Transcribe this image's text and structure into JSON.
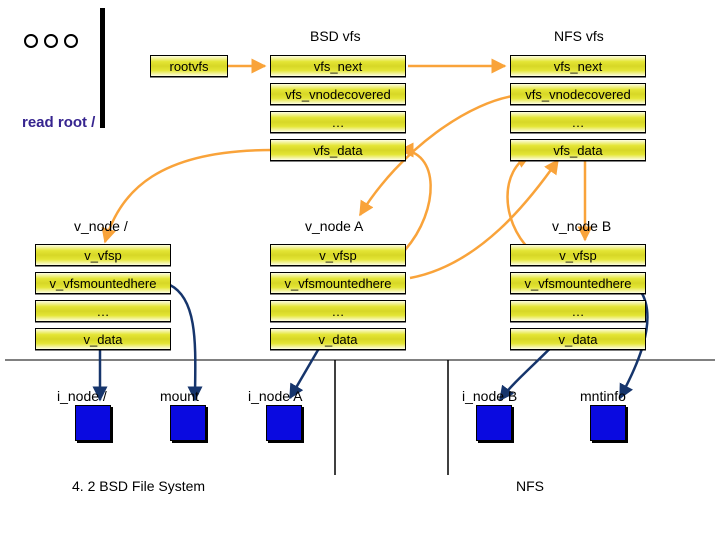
{
  "headers": {
    "bsd": "BSD vfs",
    "nfs": "NFS vfs"
  },
  "rootvfs": "rootvfs",
  "readroot": "read root /",
  "vfsCols": {
    "bsd": [
      "vfs_next",
      "vfs_vnodecovered",
      "…",
      "vfs_data"
    ],
    "nfs": [
      "vfs_next",
      "vfs_vnodecovered",
      "…",
      "vfs_data"
    ]
  },
  "vnodeTitles": {
    "root": "v_node /",
    "a": "v_node A",
    "b": "v_node B"
  },
  "vnodeCols": {
    "root": [
      "v_vfsp",
      "v_vfsmountedhere",
      "…",
      "v_data"
    ],
    "a": [
      "v_vfsp",
      "v_vfsmountedhere",
      "…",
      "v_data"
    ],
    "b": [
      "v_vfsp",
      "v_vfsmountedhere",
      "…",
      "v_data"
    ]
  },
  "bottomLabels": {
    "inodeRoot": "i_node /",
    "mount": "mount",
    "inodeA": "i_node A",
    "inodeB": "i_node B",
    "mntinfo": "mntinfo"
  },
  "footer": {
    "left": "4. 2 BSD File System",
    "right": "NFS"
  }
}
